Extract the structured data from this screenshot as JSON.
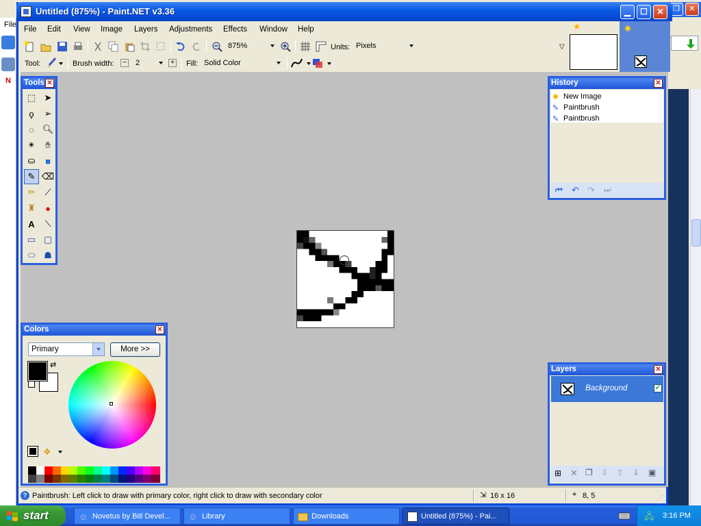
{
  "window": {
    "title": "Untitled (875%) - Paint.NET v3.36"
  },
  "background_app": {
    "menu_fragment": "File"
  },
  "menu": [
    "File",
    "Edit",
    "View",
    "Image",
    "Layers",
    "Adjustments",
    "Effects",
    "Window",
    "Help"
  ],
  "toolbar": {
    "zoom": "875%",
    "units_label": "Units:",
    "units_value": "Pixels"
  },
  "tool_options": {
    "tool_label": "Tool:",
    "brush_width_label": "Brush width:",
    "brush_width_value": "2",
    "fill_label": "Fill:",
    "fill_value": "Solid Color"
  },
  "panels": {
    "tools": {
      "title": "Tools"
    },
    "history": {
      "title": "History",
      "items": [
        {
          "label": "New Image",
          "icon": "new-image-icon"
        },
        {
          "label": "Paintbrush",
          "icon": "paintbrush-icon"
        },
        {
          "label": "Paintbrush",
          "icon": "paintbrush-icon"
        }
      ]
    },
    "layers": {
      "title": "Layers",
      "items": [
        {
          "name": "Background",
          "visible": true
        }
      ]
    },
    "colors": {
      "title": "Colors",
      "mode": "Primary",
      "more_button": "More >>",
      "primary_color": "#000000",
      "secondary_color": "#ffffff"
    }
  },
  "statusbar": {
    "message": "Paintbrush: Left click to draw with primary color, right click to draw with secondary color",
    "image_size": "16 x 16",
    "cursor_position": "8, 5"
  },
  "taskbar": {
    "start_label": "start",
    "tasks": [
      {
        "label": "Novetus by Bitl Devel...",
        "active": false
      },
      {
        "label": "Library",
        "active": false
      },
      {
        "label": "Downloads",
        "active": false
      },
      {
        "label": "Untitled (875%) - Pai...",
        "active": true
      }
    ],
    "clock": "3:16 PM"
  },
  "colors": {
    "titlebar": "#0a5be8",
    "panel_border": "#2a5fe0",
    "workspace": "#c0c0c0",
    "taskbar": "#245edb",
    "start": "#3a9b36"
  }
}
